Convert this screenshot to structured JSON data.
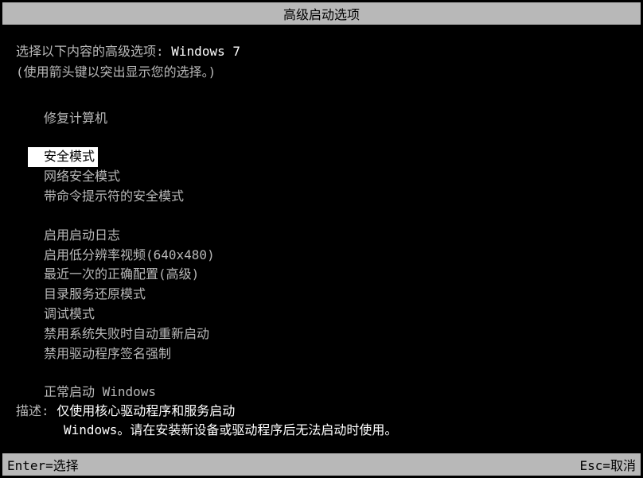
{
  "title": "高级启动选项",
  "prompt": {
    "label": "选择以下内容的高级选项:",
    "os": "Windows 7",
    "instruction": "(使用箭头键以突出显示您的选择。)"
  },
  "menu": {
    "group1": [
      "修复计算机"
    ],
    "group2": [
      "安全模式",
      "网络安全模式",
      "带命令提示符的安全模式"
    ],
    "group3": [
      "启用启动日志",
      "启用低分辨率视频(640x480)",
      "最近一次的正确配置(高级)",
      "目录服务还原模式",
      "调试模式",
      "禁用系统失败时自动重新启动",
      "禁用驱动程序签名强制"
    ],
    "group4": [
      "正常启动 Windows"
    ],
    "selected_index": "group2.0"
  },
  "description": {
    "label": "描述:",
    "line1": "仅使用核心驱动程序和服务启动",
    "line2": "Windows。请在安装新设备或驱动程序后无法启动时使用。"
  },
  "footer": {
    "enter": "Enter=选择",
    "esc": "Esc=取消"
  }
}
